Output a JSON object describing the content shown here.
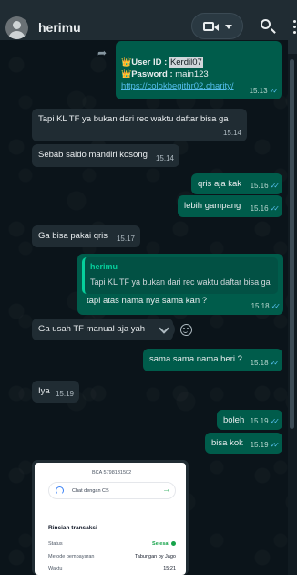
{
  "header": {
    "contact_name": "herimu",
    "avatar_icon": "default-avatar-icon",
    "video_icon": "video-call-icon",
    "menu_icon": "more-vertical-icon",
    "search_icon": "search-icon"
  },
  "messages": [
    {
      "id": "m1",
      "direction": "out",
      "forwarded": true,
      "lines": [
        "User ID : ",
        "Kerdil07",
        "Pasword : ",
        "main123"
      ],
      "link": "https://colokbegithr02.charity/",
      "time": "15.13"
    },
    {
      "id": "m2",
      "direction": "in",
      "text": "Tapi KL TF ya bukan dari rec waktu daftar bisa ga",
      "time": "15.14"
    },
    {
      "id": "m3",
      "direction": "in",
      "text": "Sebab saldo mandiri kosong",
      "time": "15.14"
    },
    {
      "id": "m4",
      "direction": "out",
      "text": "qris aja kak",
      "time": "15.16"
    },
    {
      "id": "m5",
      "direction": "out",
      "text": "lebih gampang",
      "time": "15.16"
    },
    {
      "id": "m6",
      "direction": "in",
      "text": "Ga bisa pakai qris",
      "time": "15.17"
    },
    {
      "id": "m7",
      "direction": "out",
      "quote_author": "herimu",
      "quote_text": "Tapi KL TF ya bukan dari rec waktu daftar bisa ga",
      "text": "tapi atas nama nya sama kan ?",
      "time": "15.18"
    },
    {
      "id": "m8",
      "direction": "in",
      "text": "Ga usah TF manual aja yah",
      "time": ""
    },
    {
      "id": "m9",
      "direction": "out",
      "text": "sama sama nama heri ?",
      "time": "15.18"
    },
    {
      "id": "m10",
      "direction": "in",
      "text": "Iya",
      "time": "15.19"
    },
    {
      "id": "m11",
      "direction": "out",
      "text": "boleh",
      "time": "15.19"
    },
    {
      "id": "m12",
      "direction": "out",
      "text": "bisa kok",
      "time": "15.19"
    }
  ],
  "receipt": {
    "bank": "BCA 5798131502",
    "cs_label": "Chat dengan CS",
    "title": "Rincian transaksi",
    "rows": [
      {
        "label": "Status",
        "value": "Selesai"
      },
      {
        "label": "Metode pembayaran",
        "value": "Tabungan by Jago"
      },
      {
        "label": "Waktu",
        "value": "15:21"
      }
    ]
  },
  "colors": {
    "incoming": "#202c33",
    "outgoing": "#005c4b",
    "read_ticks": "#53bdeb",
    "quote_accent": "#06cf9c"
  }
}
